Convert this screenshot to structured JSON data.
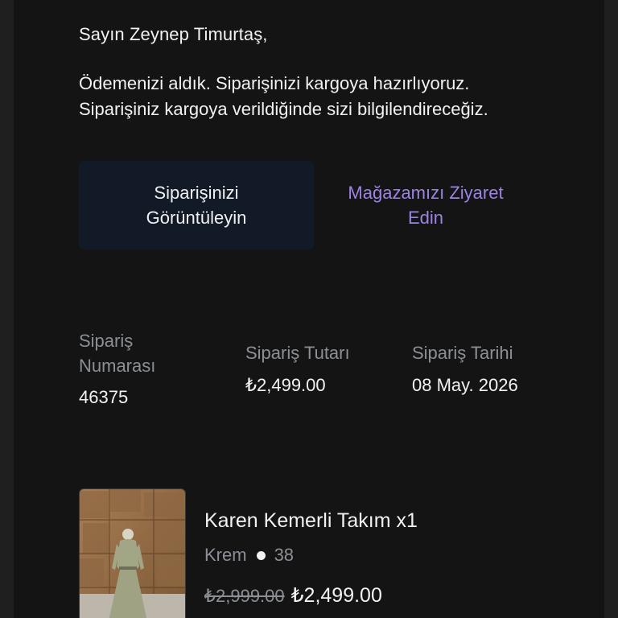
{
  "greeting": "Sayın Zeynep Timurtaş,",
  "message": {
    "line1": "Ödemenizi aldık. Siparişinizi kargoya hazırlıyoruz.",
    "line2": "Siparişiniz kargoya verildiğinde sizi bilgilendireceğiz."
  },
  "buttons": {
    "view_order": "Siparişinizi Görüntüleyin",
    "visit_store": "Mağazamızı Ziyaret Edin"
  },
  "order_info": {
    "number_label": "Sipariş Numarası",
    "number_value": "46375",
    "total_label": "Sipariş Tutarı",
    "total_value": "₺2,499.00",
    "date_label": "Sipariş Tarihi",
    "date_value": "08 May. 2026"
  },
  "product": {
    "name": "Karen Kemerli Takım x1",
    "color": "Krem",
    "size": "38",
    "old_price": "₺2,999.00",
    "price": "₺2,499.00"
  },
  "colors": {
    "background": "#141414",
    "primary_button": "#121a27",
    "link": "#9b84e3",
    "muted_text": "#8c8f96"
  }
}
